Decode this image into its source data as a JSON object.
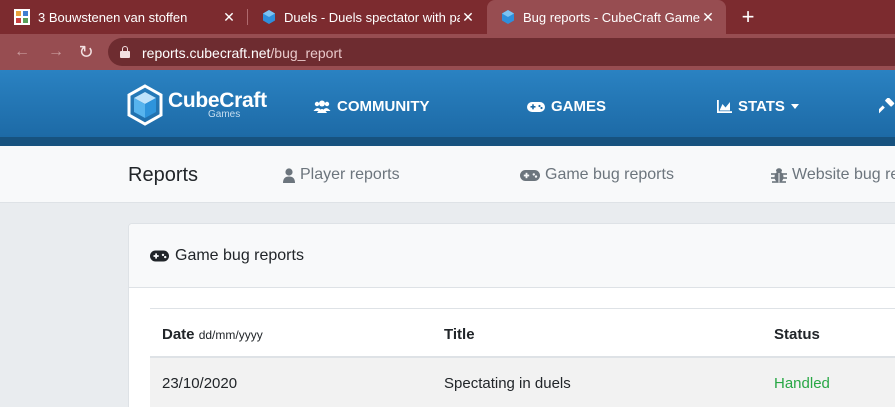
{
  "browser": {
    "tabs": [
      {
        "title": "3 Bouwstenen van stoffen",
        "close": "✕"
      },
      {
        "title": "Duels - Duels spectator with part",
        "close": "✕"
      },
      {
        "title": "Bug reports - CubeCraft Games",
        "close": "✕"
      }
    ],
    "new_tab": "+",
    "url_host": "reports.cubecraft.net",
    "url_path": "/bug_report",
    "back": "←",
    "forward": "→",
    "reload": "↻"
  },
  "site": {
    "logo_name": "CubeCraft",
    "logo_sub": "Games",
    "nav": [
      {
        "label": "COMMUNITY",
        "icon": "users-icon"
      },
      {
        "label": "GAMES",
        "icon": "gamepad-icon"
      },
      {
        "label": "STATS",
        "icon": "chart-icon"
      },
      {
        "label": "",
        "icon": "hammer-icon"
      }
    ]
  },
  "subnav": {
    "title": "Reports",
    "links": [
      {
        "label": "Player reports",
        "icon": "user-icon"
      },
      {
        "label": "Game bug reports",
        "icon": "gamepad-icon"
      },
      {
        "label": "Website bug re",
        "icon": "bug-icon"
      }
    ]
  },
  "card": {
    "title": "Game bug reports",
    "columns": {
      "date": "Date",
      "date_format": "dd/mm/yyyy",
      "title": "Title",
      "status": "Status"
    },
    "rows": [
      {
        "date": "23/10/2020",
        "title": "Spectating in duels",
        "status": "Handled"
      }
    ]
  },
  "colors": {
    "tabbar": "#7c2b2f",
    "toolbar": "#974d51",
    "site_nav": "#1d6aa6",
    "status_handled": "#28a745"
  }
}
